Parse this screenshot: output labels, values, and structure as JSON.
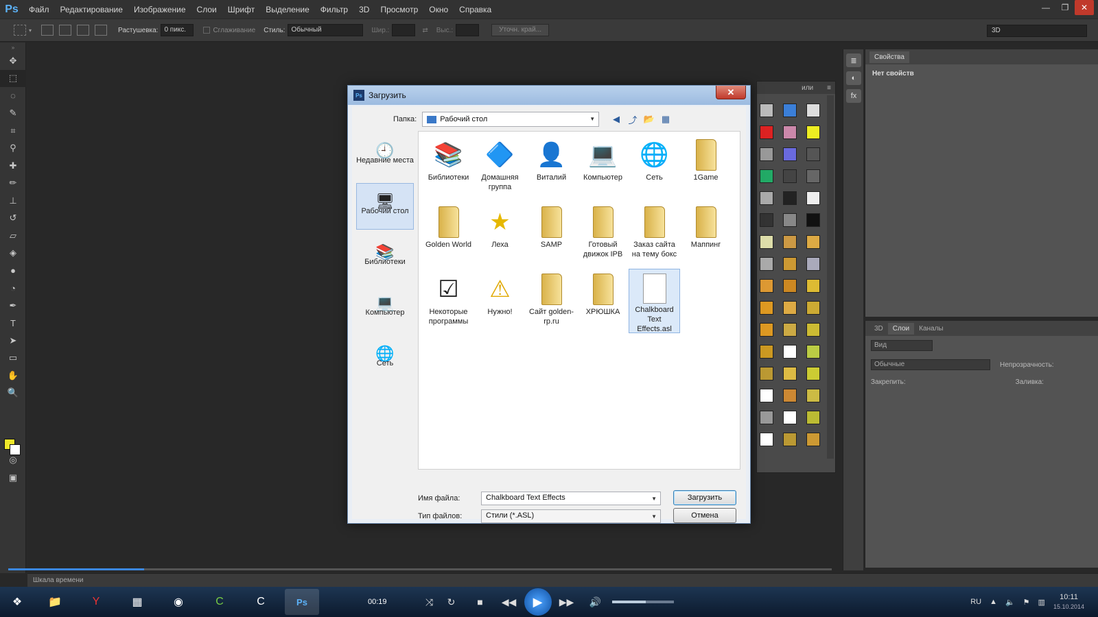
{
  "app": {
    "logo": "Ps",
    "menu": [
      "Файл",
      "Редактирование",
      "Изображение",
      "Слои",
      "Шрифт",
      "Выделение",
      "Фильтр",
      "3D",
      "Просмотр",
      "Окно",
      "Справка"
    ]
  },
  "options": {
    "feather_label": "Растушевка:",
    "feather_value": "0 пикс.",
    "antialias_label": "Сглаживание",
    "style_label": "Стиль:",
    "style_value": "Обычный",
    "width_label": "Шир.:",
    "height_label": "Выс.:",
    "refine_label": "Уточн. край...",
    "workspace": "3D"
  },
  "panels": {
    "properties_tab": "Свойства",
    "no_properties": "Нет свойств",
    "tabs": [
      "3D",
      "Слои",
      "Каналы"
    ],
    "kind_label": "Вид",
    "blend_mode": "Обычные",
    "opacity_label": "Непрозрачность:",
    "lock_label": "Закрепить:",
    "fill_label": "Заливка:",
    "styles_tab_partial": "или"
  },
  "timeline": {
    "label": "Шкала времени",
    "progress": 0.165
  },
  "dialog": {
    "title": "Загрузить",
    "folder_label": "Папка:",
    "folder_value": "Рабочий стол",
    "places": [
      {
        "label": "Недавние места",
        "icon": "recent-places-icon",
        "glyph": "🕘"
      },
      {
        "label": "Рабочий стол",
        "icon": "desktop-icon",
        "glyph": "🖥"
      },
      {
        "label": "Библиотеки",
        "icon": "libraries-icon",
        "glyph": "📚"
      },
      {
        "label": "Компьютер",
        "icon": "computer-icon",
        "glyph": "💻"
      },
      {
        "label": "Сеть",
        "icon": "network-icon",
        "glyph": "🌐"
      }
    ],
    "files": [
      {
        "label": "Библиотеки",
        "type": "libraries",
        "glyph": "📚"
      },
      {
        "label": "Домашняя группа",
        "type": "homegroup",
        "glyph": "🔷"
      },
      {
        "label": "Виталий",
        "type": "user-folder",
        "glyph": "👤"
      },
      {
        "label": "Компьютер",
        "type": "computer",
        "glyph": "💻"
      },
      {
        "label": "Сеть",
        "type": "network",
        "glyph": "🌐"
      },
      {
        "label": "1Game",
        "type": "folder"
      },
      {
        "label": "Golden World",
        "type": "folder"
      },
      {
        "label": "Леха",
        "type": "star",
        "glyph": "★"
      },
      {
        "label": "SAMP",
        "type": "folder"
      },
      {
        "label": "Готовый движок IPB",
        "type": "folder"
      },
      {
        "label": "Заказ сайта на тему бокс",
        "type": "folder"
      },
      {
        "label": "Маппинг",
        "type": "folder"
      },
      {
        "label": "Некоторые программы",
        "type": "shortcut",
        "glyph": "☑"
      },
      {
        "label": "Нужно!",
        "type": "warning",
        "glyph": "⚠"
      },
      {
        "label": "Сайт golden-rp.ru",
        "type": "folder"
      },
      {
        "label": "ХРЮШКА",
        "type": "folder"
      },
      {
        "label": "Chalkboard Text Effects.asl",
        "type": "document"
      }
    ],
    "filename_label": "Имя файла:",
    "filename_value": "Chalkboard Text Effects",
    "filetype_label": "Тип файлов:",
    "filetype_value": "Стили (*.ASL)",
    "open_button": "Загрузить",
    "cancel_button": "Отмена"
  },
  "taskbar": {
    "time": "00:19",
    "lang": "RU",
    "clock_time": "10:11",
    "clock_date": "15.10.2014",
    "volume": 0.55
  }
}
